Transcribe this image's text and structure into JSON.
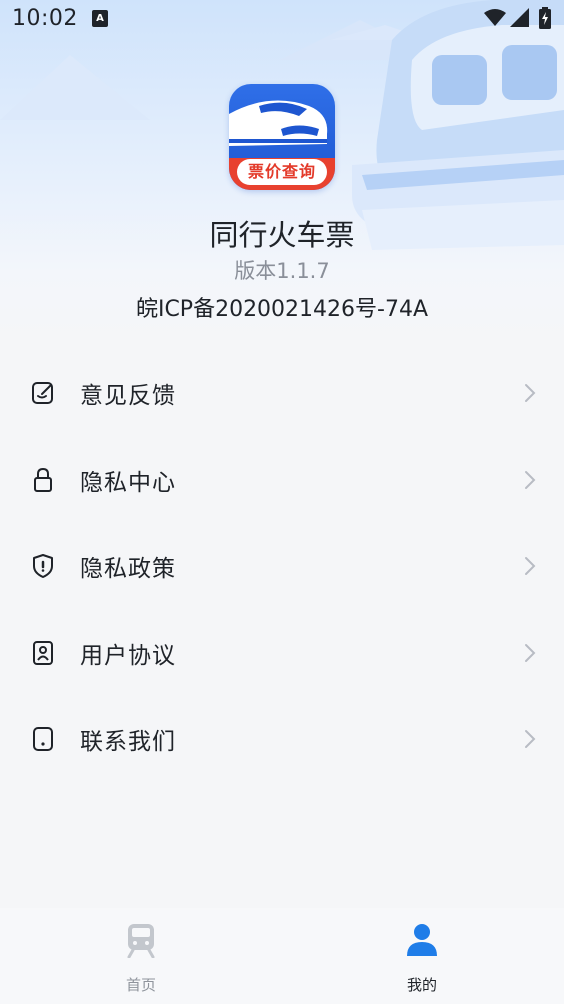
{
  "status_bar": {
    "time": "10:02",
    "notification_glyph": "A",
    "icons": [
      "notification-icon",
      "wifi-icon",
      "signal-icon",
      "battery-icon"
    ]
  },
  "app_info": {
    "name": "同行火车票",
    "version": "版本1.1.7",
    "icp": "皖ICP备2020021426号-74A",
    "icon_label": "票价查询",
    "icon_colors": {
      "primary": "#1e56d0",
      "label_bg": "#ffffff",
      "label_text": "#e33a2a"
    }
  },
  "menu": {
    "items": [
      {
        "label": "意见反馈",
        "icon": "feedback-edit-icon"
      },
      {
        "label": "隐私中心",
        "icon": "lock-icon"
      },
      {
        "label": "隐私政策",
        "icon": "shield-icon"
      },
      {
        "label": "用户协议",
        "icon": "agreement-icon"
      },
      {
        "label": "联系我们",
        "icon": "phone-icon"
      }
    ]
  },
  "tab_bar": {
    "tabs": [
      {
        "label": "首页",
        "icon": "train-icon",
        "active": false
      },
      {
        "label": "我的",
        "icon": "user-icon",
        "active": true
      }
    ],
    "active_color": "#1f7de8",
    "inactive_color": "#9aa0a8"
  }
}
